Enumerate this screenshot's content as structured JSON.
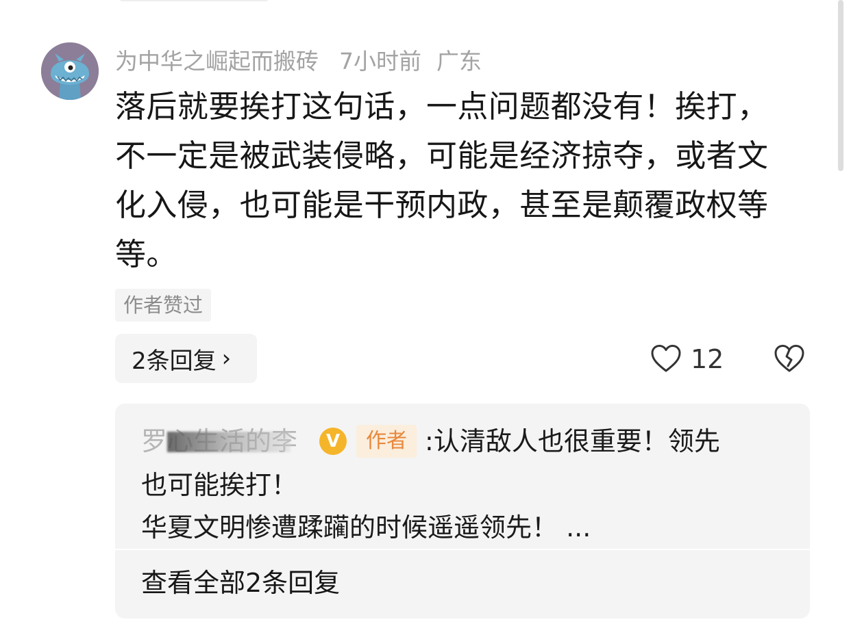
{
  "comment": {
    "username": "为中华之崛起而搬砖",
    "time": "7小时前",
    "location": "广东",
    "avatar_icon": "cartoon-monster-avatar",
    "text_lines": [
      "落后就要挨打这句话，一点问题都没有！挨打，",
      "不一定是被武装侵略，可能是经济掠夺，或者文",
      "化入侵，也可能是干预内政，甚至是颠覆政权等",
      "等。"
    ],
    "author_liked_label": "作者赞过",
    "replies_button_label": "2条回复",
    "replies_chevron": "›",
    "like_count": "12",
    "like_icon": "heart-outline-icon",
    "dislike_icon": "broken-heart-icon"
  },
  "reply_preview": {
    "author_name": "罗心生活的李",
    "verified_badge": "V",
    "author_tag": "作者",
    "colon": ":",
    "line1_text": "认清敌人也很重要！领先",
    "line2_text": "也可能挨打！",
    "line3_text": "华夏文明惨遭蹂躏的时候遥遥领先！ ..."
  },
  "view_all_label": "查看全部2条回复",
  "colors": {
    "meta_gray": "#a3a3a3",
    "tag_background": "#f4f4f4",
    "author_tag_orange": "#e7883c",
    "verified_gold": "#f5b52a",
    "avatar_purple": "#8c7e98"
  }
}
